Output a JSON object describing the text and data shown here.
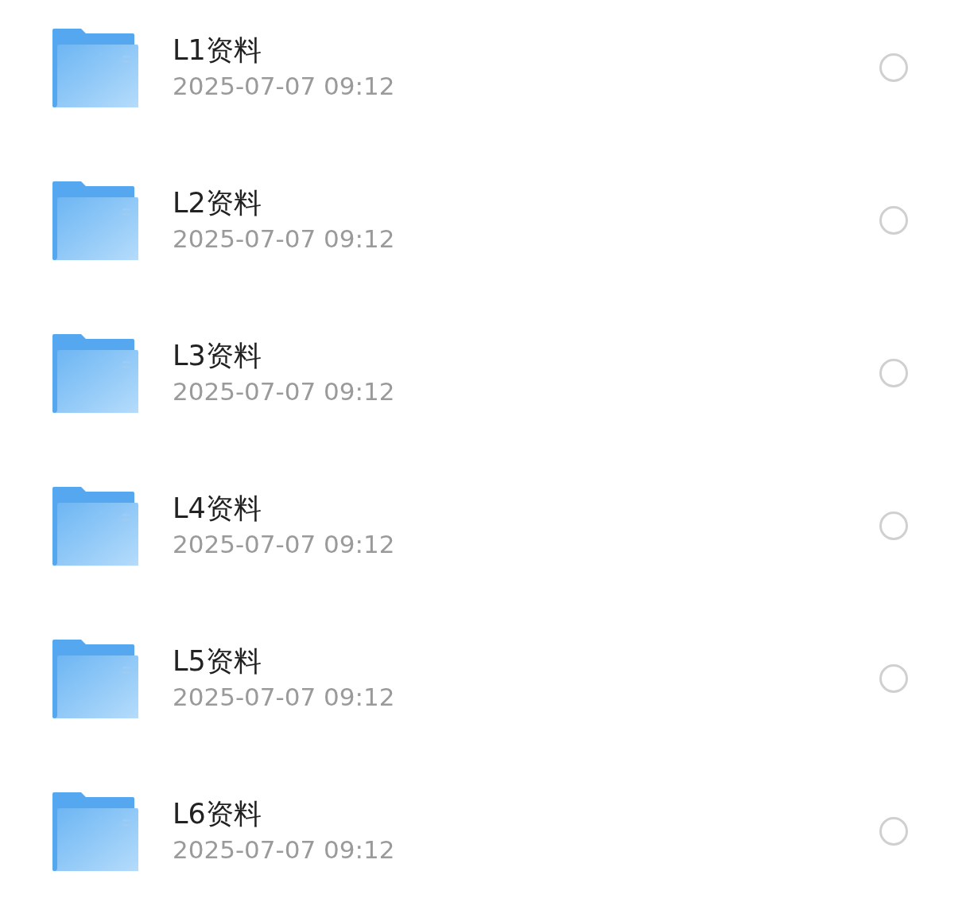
{
  "files": [
    {
      "name": "L1资料",
      "modified": "2025-07-07 09:12",
      "selected": false
    },
    {
      "name": "L2资料",
      "modified": "2025-07-07 09:12",
      "selected": false
    },
    {
      "name": "L3资料",
      "modified": "2025-07-07 09:12",
      "selected": false
    },
    {
      "name": "L4资料",
      "modified": "2025-07-07 09:12",
      "selected": false
    },
    {
      "name": "L5资料",
      "modified": "2025-07-07 09:12",
      "selected": false
    },
    {
      "name": "L6资料",
      "modified": "2025-07-07 09:12",
      "selected": false
    }
  ]
}
